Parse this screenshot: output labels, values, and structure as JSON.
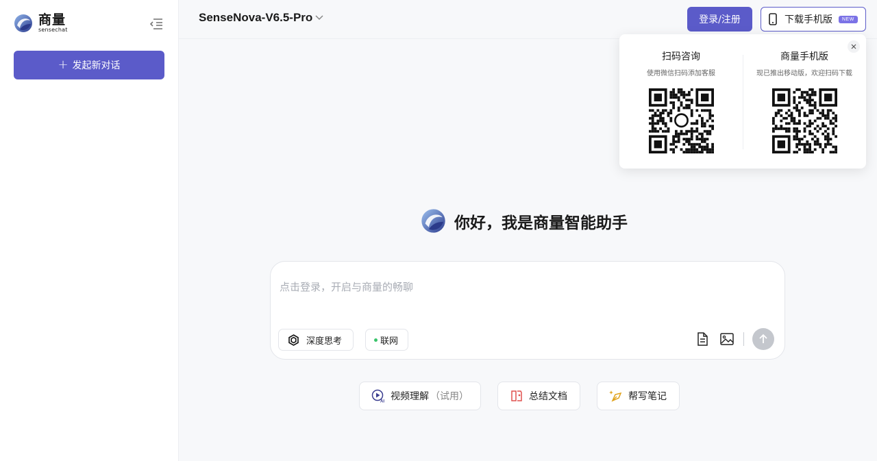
{
  "brand": {
    "name_cn": "商量",
    "name_en": "sensechat"
  },
  "sidebar": {
    "new_chat_label": "发起新对话"
  },
  "header": {
    "model_name": "SenseNova-V6.5-Pro",
    "login_label": "登录/注册",
    "download_label": "下载手机版",
    "download_badge": "NEW"
  },
  "qr_popup": {
    "left": {
      "title": "扫码咨询",
      "subtitle": "使用微信扫码添加客服"
    },
    "right": {
      "title": "商量手机版",
      "subtitle": "现已推出移动版，欢迎扫码下载"
    }
  },
  "main": {
    "greeting": "你好，我是商量智能助手",
    "input_placeholder": "点击登录，开启与商量的畅聊",
    "chips": {
      "deep_think": "深度思考",
      "web": "联网"
    },
    "quick_actions": {
      "video": "视频理解",
      "video_suffix": "（试用）",
      "summary": "总结文档",
      "note": "帮写笔记"
    }
  },
  "colors": {
    "accent": "#5b5bc9",
    "badge": "#7b72e6",
    "web_dot": "#3ac46b"
  }
}
